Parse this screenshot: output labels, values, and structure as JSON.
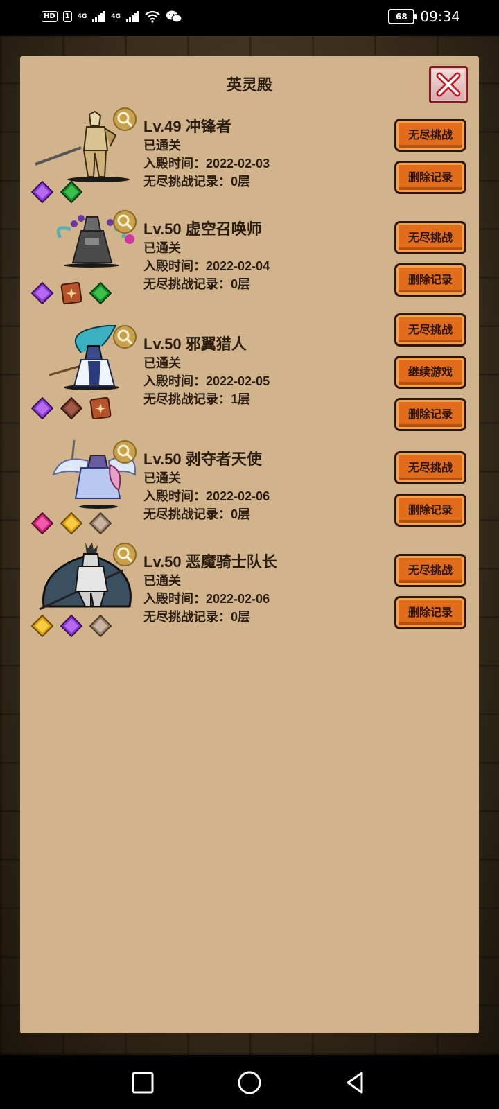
{
  "status_bar": {
    "hd_badge": "HD",
    "sim_badge": "1",
    "net1": "4G",
    "net2": "4G",
    "battery": "68",
    "time": "09:34"
  },
  "panel": {
    "title": "英灵殿"
  },
  "entries": [
    {
      "name": "Lv.49 冲锋者",
      "status": "已通关",
      "date_line": "入殿时间：2022-02-03",
      "record_line": "无尽挑战记录：0层",
      "buttons": [
        "无尽挑战",
        "删除记录"
      ],
      "gems": [
        "purple",
        "green"
      ]
    },
    {
      "name": "Lv.50 虚空召唤师",
      "status": "已通关",
      "date_line": "入殿时间：2022-02-04",
      "record_line": "无尽挑战记录：0层",
      "buttons": [
        "无尽挑战",
        "删除记录"
      ],
      "gems": [
        "purple",
        "rune",
        "green"
      ]
    },
    {
      "name": "Lv.50 邪翼猎人",
      "status": "已通关",
      "date_line": "入殿时间：2022-02-05",
      "record_line": "无尽挑战记录：1层",
      "buttons": [
        "无尽挑战",
        "继续游戏",
        "删除记录"
      ],
      "gems": [
        "purple",
        "brown",
        "rune"
      ]
    },
    {
      "name": "Lv.50 剥夺者天使",
      "status": "已通关",
      "date_line": "入殿时间：2022-02-06",
      "record_line": "无尽挑战记录：0层",
      "buttons": [
        "无尽挑战",
        "删除记录"
      ],
      "gems": [
        "pink",
        "gold",
        "tan"
      ]
    },
    {
      "name": "Lv.50 恶魔骑士队长",
      "status": "已通关",
      "date_line": "入殿时间：2022-02-06",
      "record_line": "无尽挑战记录：0层",
      "buttons": [
        "无尽挑战",
        "删除记录"
      ],
      "gems": [
        "gold",
        "purple",
        "tan"
      ]
    }
  ],
  "colors": {
    "panel_bg": "#d2b48c",
    "button_orange": "#e06c1c",
    "close_border": "#7a1d1d",
    "text_dark": "#2a1d10"
  }
}
